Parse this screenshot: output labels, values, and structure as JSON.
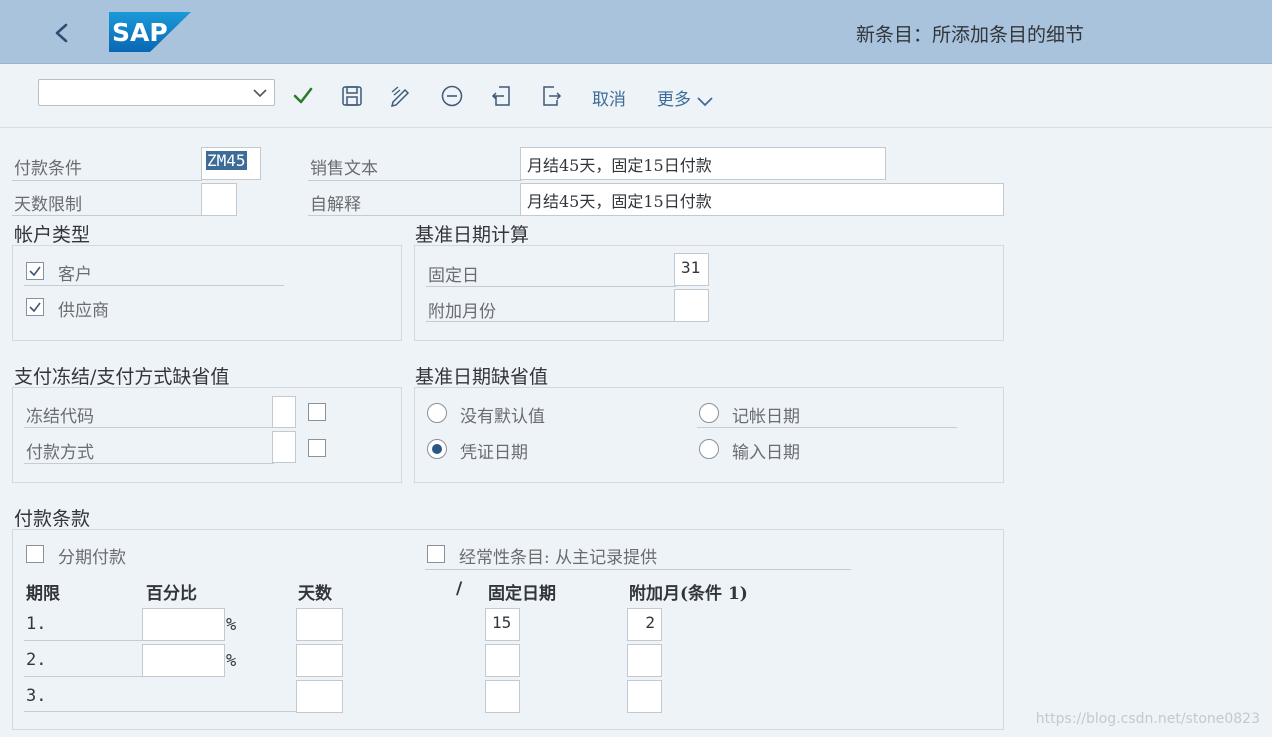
{
  "header": {
    "title": "新条目：所添加条目的细节",
    "logo_text": "SAP"
  },
  "toolbar": {
    "cancel": "取消",
    "more": "更多",
    "dropdown_value": ""
  },
  "top": {
    "pay_term_label": "付款条件",
    "pay_term_value": "ZM45",
    "days_limit_label": "天数限制",
    "days_limit_value": "",
    "sales_text_label": "销售文本",
    "sales_text_value": "月结45天，固定15日付款",
    "self_expl_label": "自解释",
    "self_expl_value": "月结45天，固定15日付款"
  },
  "account_type": {
    "title": "帐户类型",
    "customer": "客户",
    "vendor": "供应商"
  },
  "baseline_calc": {
    "title": "基准日期计算",
    "fixed_day_label": "固定日",
    "fixed_day_value": "31",
    "add_month_label": "附加月份",
    "add_month_value": ""
  },
  "block": {
    "title": "支付冻结/支付方式缺省值",
    "block_code": "冻结代码",
    "pay_method": "付款方式"
  },
  "baseline_default": {
    "title": "基准日期缺省值",
    "no_default": "没有默认值",
    "posting_date": "记帐日期",
    "doc_date": "凭证日期",
    "entry_date": "输入日期"
  },
  "terms": {
    "title": "付款条款",
    "installment": "分期付款",
    "recurring": "经常性条目: 从主记录提供",
    "col_term": "期限",
    "col_percent": "百分比",
    "col_days": "天数",
    "col_slash": "/",
    "col_fixed": "固定日期",
    "col_addmonth": "附加月(条件 1)",
    "rows": [
      {
        "num": "1.",
        "pct_unit": "%",
        "fixed": "15",
        "add": "2"
      },
      {
        "num": "2.",
        "pct_unit": "%",
        "fixed": "",
        "add": ""
      },
      {
        "num": "3.",
        "fixed": "",
        "add": ""
      }
    ]
  },
  "watermark": "https://blog.csdn.net/stone0823",
  "colors": {
    "header_bg": "#a9c3dd",
    "accent": "#3d6c99",
    "check_green": "#2b7d2b",
    "radio_selected": "#2a5683"
  }
}
